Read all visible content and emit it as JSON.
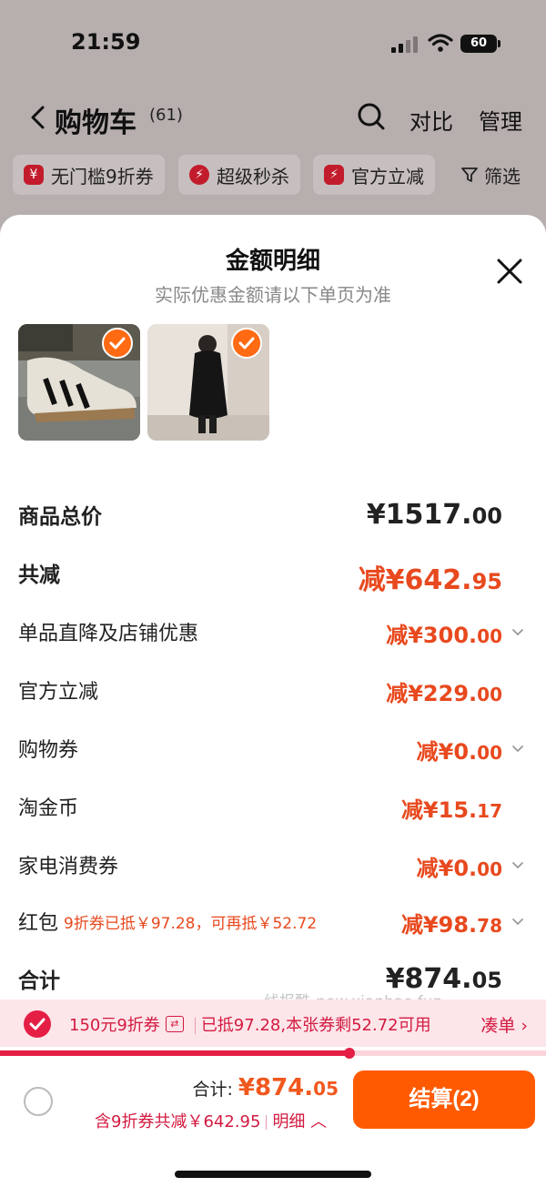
{
  "status_bar": {
    "time": "21:59",
    "battery": "60"
  },
  "nav": {
    "title": "购物车",
    "count": "(61)",
    "compare": "对比",
    "manage": "管理"
  },
  "filters": [
    {
      "icon": "coupon-icon",
      "label": "无门槛9折券"
    },
    {
      "icon": "flash-icon",
      "label": "超级秒杀"
    },
    {
      "icon": "flash-icon",
      "label": "官方立减"
    },
    {
      "icon": "filter-icon",
      "label": "筛选"
    }
  ],
  "sheet": {
    "title": "金额明细",
    "subtitle": "实际优惠金额请以下单页为准",
    "products": [
      "sneakers-image",
      "down-coat-image"
    ],
    "rows": [
      {
        "label": "商品总价",
        "value": "¥1517.",
        "dec": "00",
        "style": "total"
      },
      {
        "label": "共减",
        "value": "减¥642.",
        "dec": "95",
        "style": "reduce"
      },
      {
        "label": "单品直降及店铺优惠",
        "value": "减¥300.",
        "dec": "00",
        "chevron": true
      },
      {
        "label": "官方立减",
        "value": "减¥229.",
        "dec": "00",
        "chevron": false
      },
      {
        "label": "购物券",
        "value": "减¥0.",
        "dec": "00",
        "chevron": true
      },
      {
        "label": "淘金币",
        "value": "减¥15.",
        "dec": "17",
        "chevron": false
      },
      {
        "label": "家电消费券",
        "value": "减¥0.",
        "dec": "00",
        "chevron": true
      },
      {
        "label": "红包",
        "note": "9折券已抵￥97.28，可再抵￥52.72",
        "value": "减¥98.",
        "dec": "78",
        "chevron": true
      },
      {
        "label": "合计",
        "value": "¥874.",
        "dec": "05",
        "style": "total"
      }
    ],
    "watermark": "线报酷-new.xianbao.fun"
  },
  "coupon": {
    "name": "150元9折券",
    "swap": "⇄",
    "status": "已抵97.28,本张券剩52.72可用",
    "cta": "凑单 ›",
    "progress": 0.64
  },
  "bottom": {
    "total_label": "合计: ",
    "total_value": "¥874.",
    "total_dec": "05",
    "discount_text": "含9折券共减￥642.95",
    "detail_link": "明细 ︿",
    "checkout": "结算(2)"
  }
}
